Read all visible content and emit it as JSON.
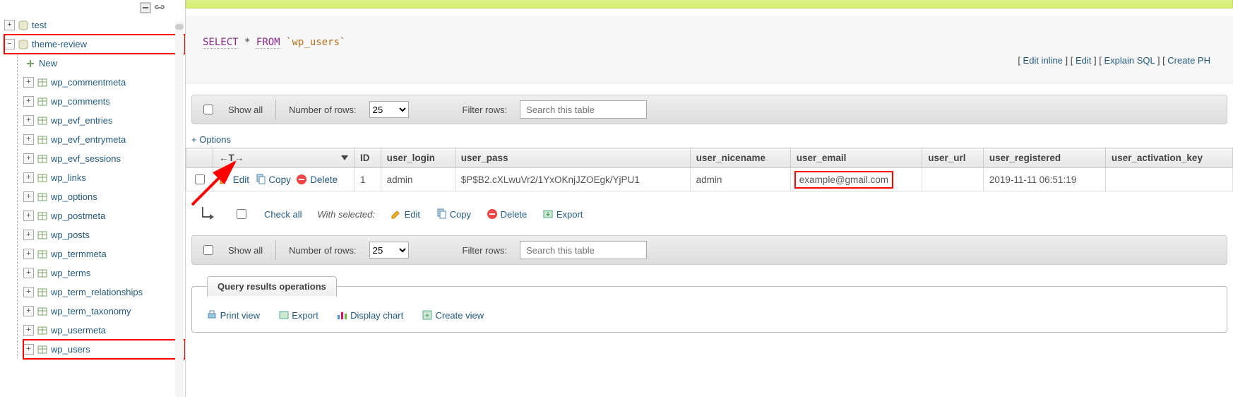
{
  "sidebar": {
    "databases": [
      {
        "name": "test",
        "children": []
      }
    ],
    "current_db": "theme-review",
    "tables": [
      "wp_commentmeta",
      "wp_comments",
      "wp_evf_entries",
      "wp_evf_entrymeta",
      "wp_evf_sessions",
      "wp_links",
      "wp_options",
      "wp_postmeta",
      "wp_posts",
      "wp_termmeta",
      "wp_terms",
      "wp_term_relationships",
      "wp_term_taxonomy",
      "wp_usermeta"
    ],
    "highlighted_table": "wp_users",
    "new_label": "New"
  },
  "query": {
    "keyword1": "SELECT",
    "star": "*",
    "keyword2": "FROM",
    "table": "`wp_users`"
  },
  "toolbar_links": {
    "edit_inline": "Edit inline",
    "edit": "Edit",
    "explain": "Explain SQL",
    "create": "Create PH"
  },
  "filter_bar": {
    "show_all": "Show all",
    "num_rows_label": "Number of rows:",
    "num_rows_value": "25",
    "filter_label": "Filter rows:",
    "filter_placeholder": "Search this table"
  },
  "options_link": "+ Options",
  "table_headers": {
    "arrow_col": "",
    "id": "ID",
    "user_login": "user_login",
    "user_pass": "user_pass",
    "user_nicename": "user_nicename",
    "user_email": "user_email",
    "user_url": "user_url",
    "user_registered": "user_registered",
    "user_activation_key": "user_activation_key"
  },
  "row": {
    "edit": "Edit",
    "copy": "Copy",
    "delete": "Delete",
    "id": "1",
    "user_login": "admin",
    "user_pass": "$P$B2.cXLwuVr2/1YxOKnjJZOEgk/YjPU1",
    "user_nicename": "admin",
    "user_email": "example@gmail.com",
    "user_url": "",
    "user_registered": "2019-11-11 06:51:19"
  },
  "bulk": {
    "check_all": "Check all",
    "with_selected": "With selected:",
    "edit": "Edit",
    "copy": "Copy",
    "delete": "Delete",
    "export": "Export"
  },
  "qro": {
    "title": "Query results operations",
    "print": "Print view",
    "export": "Export",
    "chart": "Display chart",
    "create_view": "Create view"
  }
}
